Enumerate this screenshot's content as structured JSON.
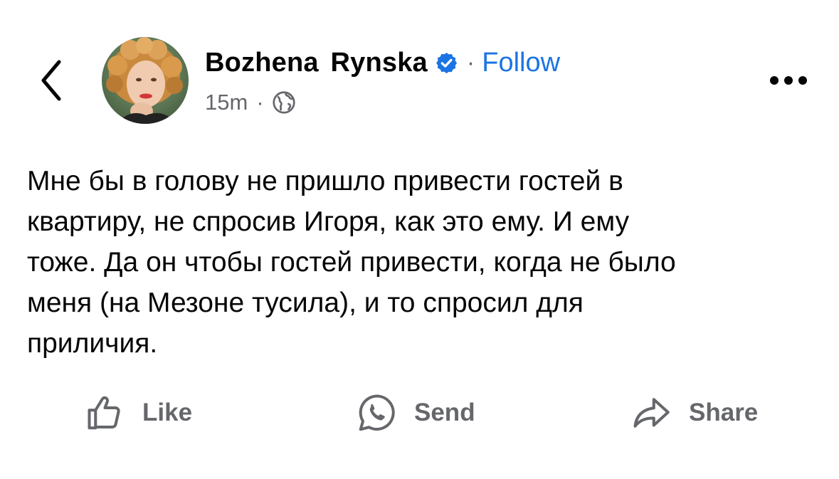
{
  "post": {
    "author": "Bozhena  Rynska",
    "verified_icon": "verified-badge-icon",
    "follow_dot": "·",
    "follow_label": "Follow",
    "time": "15m",
    "time_dot": "·",
    "audience_icon": "globe-icon",
    "text": "Мне бы в голову не пришло привести гостей в\nквартиру, не спросив Игоря, как это ему. И ему\nтоже. Да он чтобы гостей привести, когда не было\nменя (на Мезоне тусила), и то спросил для\nприличия."
  },
  "actions": {
    "like_label": "Like",
    "send_label": "Send",
    "share_label": "Share"
  },
  "colors": {
    "link_blue": "#1b74e4",
    "verified_blue": "#1b74e4",
    "secondary_text": "#65676b",
    "primary_text": "#050505"
  }
}
